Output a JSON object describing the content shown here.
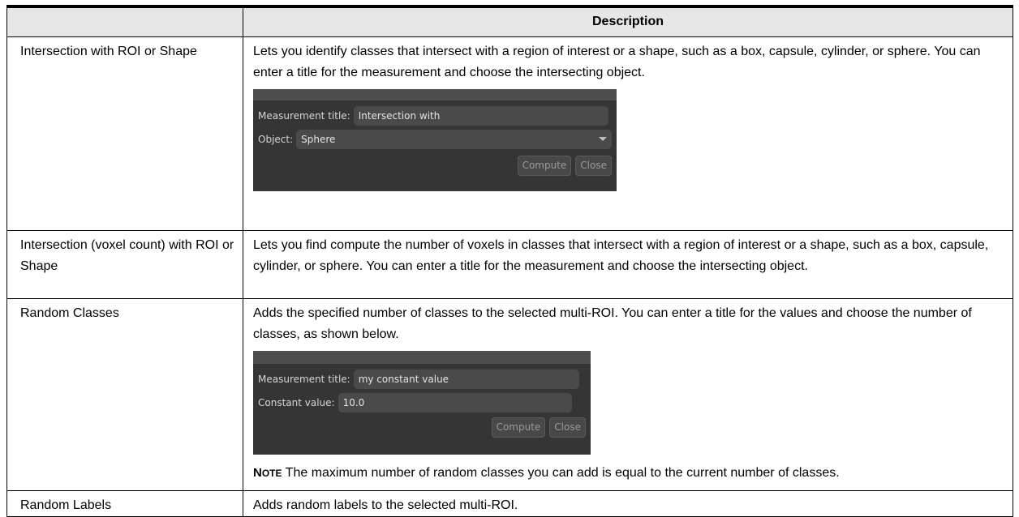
{
  "header": {
    "col1": "",
    "col2": "Description"
  },
  "rows": [
    {
      "name": "Intersection with ROI or Shape",
      "description": "Lets you identify classes that intersect with a region of interest or a shape, such as a box, capsule, cylinder, or sphere. You can enter a title for the measurement and choose the intersecting object.",
      "dialog": {
        "title_label": "Measurement title:",
        "title_value": "Intersection with",
        "object_label": "Object:",
        "object_value": "Sphere",
        "compute_label": "Compute",
        "close_label": "Close"
      }
    },
    {
      "name": "Intersection (voxel count) with ROI or Shape",
      "description": "Lets you find compute the number of voxels in classes that intersect with a region of interest or a shape, such as a box, capsule, cylinder, or sphere. You can enter a title for the measurement and choose the intersecting object."
    },
    {
      "name": "Random Classes",
      "description": "Adds the specified number of classes to the selected multi-ROI. You can enter a title for the values and choose the number of classes, as shown below.",
      "dialog": {
        "title_label": "Measurement title:",
        "title_value": "my constant value",
        "constant_label": "Constant value:",
        "constant_value": "10.0",
        "compute_label": "Compute",
        "close_label": "Close"
      },
      "note": {
        "label_first": "N",
        "label_rest": "OTE",
        "text": "The maximum number of random classes you can add is equal to the current number of classes."
      }
    },
    {
      "name": "Random Labels",
      "description": "Adds random labels to the selected multi-ROI."
    }
  ],
  "colors": {
    "dialog_bg": "#353535",
    "header_bg": "#e6e6e6"
  }
}
